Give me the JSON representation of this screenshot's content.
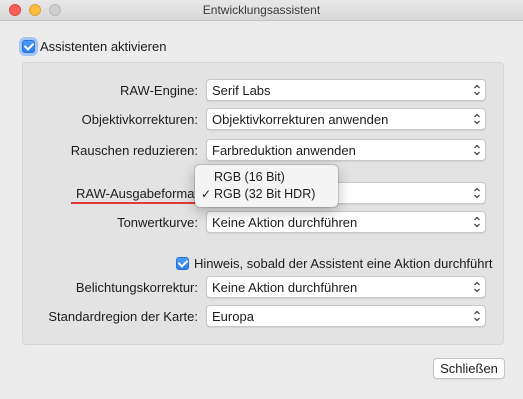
{
  "window": {
    "title": "Entwicklungsassistent"
  },
  "assistant_toggle": {
    "label": "Assistenten aktivieren",
    "checked": true
  },
  "settings": {
    "raw_engine": {
      "label": "RAW-Engine:",
      "value": "Serif Labs"
    },
    "lens_corrections": {
      "label": "Objektivkorrekturen:",
      "value": "Objektivkorrekturen anwenden"
    },
    "noise_reduction": {
      "label": "Rauschen reduzieren:",
      "value": "Farbreduktion anwenden"
    },
    "raw_output_format": {
      "label": "RAW-Ausgabeformat"
    },
    "tone_curve": {
      "label": "Tonwertkurve:",
      "value": "Keine Aktion durchführen"
    },
    "notify": {
      "label": "Hinweis, sobald der Assistent eine Aktion durchführt",
      "checked": true
    },
    "exposure": {
      "label": "Belichtungskorrektur:",
      "value": "Keine Aktion durchführen"
    },
    "map_region": {
      "label": "Standardregion der Karte:",
      "value": "Europa"
    }
  },
  "output_format_menu": {
    "options": [
      "RGB (16 Bit)",
      "RGB (32 Bit HDR)"
    ],
    "selected_index": 1,
    "check_glyph": "✓"
  },
  "close_button": {
    "label": "Schließen"
  },
  "colors": {
    "accent": "#2a7ff0",
    "annotation_underline": "#e03a3a"
  }
}
